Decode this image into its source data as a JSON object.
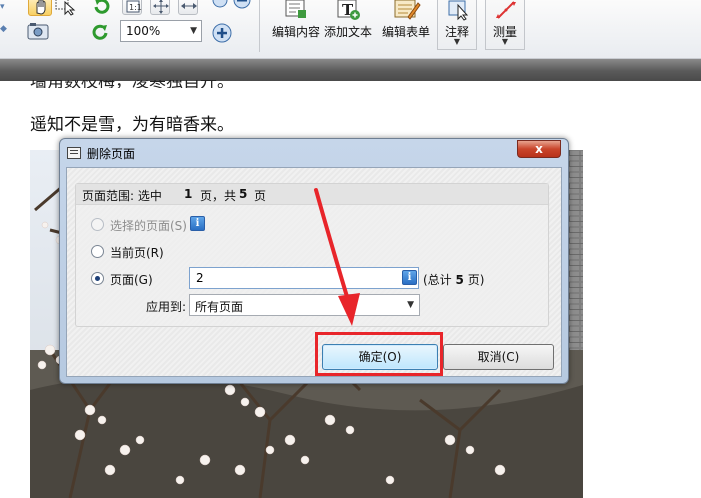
{
  "toolbar": {
    "zoom_value": "100%",
    "tools": [
      {
        "name": "edit-content",
        "label": "编辑内容"
      },
      {
        "name": "add-text",
        "label": "添加文本"
      },
      {
        "name": "edit-form",
        "label": "编辑表单"
      }
    ],
    "annotate_label": "注释",
    "measure_label": "测量"
  },
  "document": {
    "partial_top_line": "墙角数枝梅，凌寒独自开。",
    "line": "遥知不是雪，为有暗香来。"
  },
  "dialog": {
    "title": "删除页面",
    "range_prefix": "页面范围: 选中",
    "selected_count": "1",
    "range_mid": "页，共",
    "total_count": "5",
    "range_suffix": "页",
    "opt_selected_pages": "选择的页面(S)",
    "opt_current_page": "当前页(R)",
    "opt_pages": "页面(G)",
    "pages_value": "2",
    "total_prefix": "(总计",
    "total_suffix": "页)",
    "apply_label": "应用到:",
    "apply_value": "所有页面",
    "ok_label": "确定(O)",
    "cancel_label": "取消(C)",
    "close_glyph": "x"
  },
  "colors": {
    "highlight": "#e8252a",
    "dialog_frame": "#b6c9e0",
    "ok_button": "#bee6fd"
  }
}
